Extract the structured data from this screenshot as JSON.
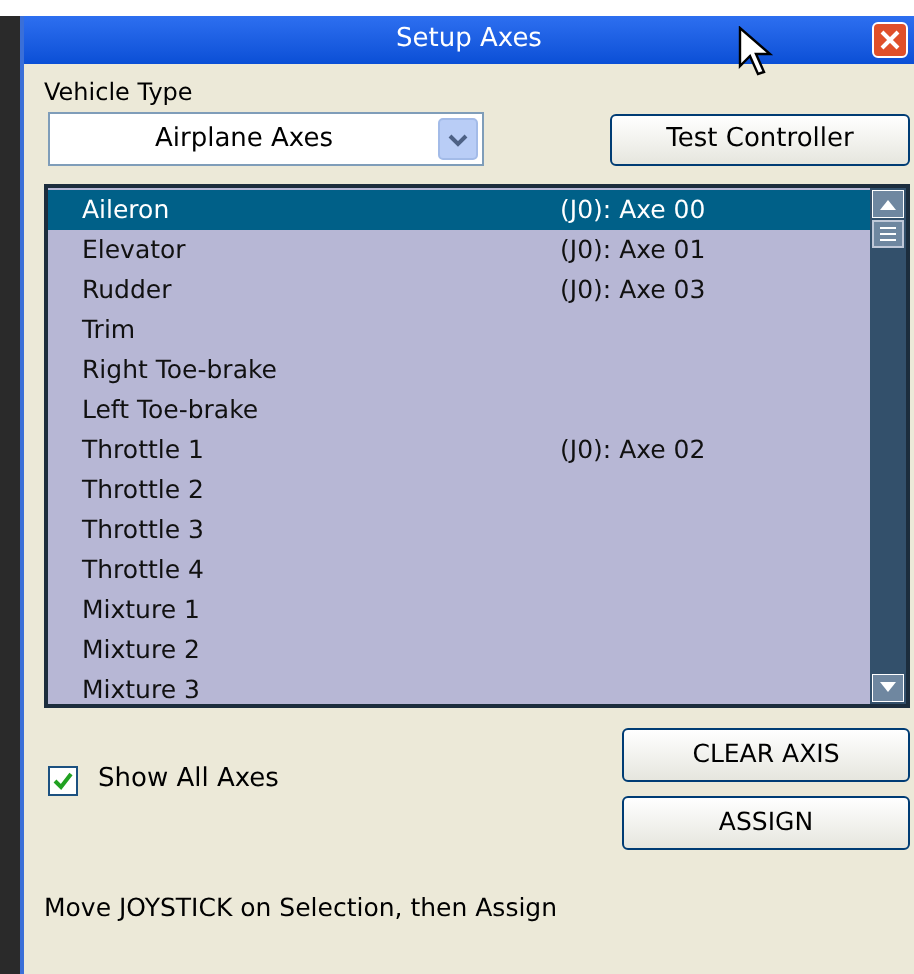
{
  "window": {
    "title": "Setup Axes"
  },
  "vehicle_type": {
    "label": "Vehicle Type",
    "value": "Airplane Axes"
  },
  "test_button": "Test Controller",
  "axes": [
    {
      "name": "Aileron",
      "assignment": "(J0): Axe 00",
      "selected": true
    },
    {
      "name": "Elevator",
      "assignment": "(J0): Axe 01",
      "selected": false
    },
    {
      "name": "Rudder",
      "assignment": "(J0): Axe 03",
      "selected": false
    },
    {
      "name": "Trim",
      "selected": false
    },
    {
      "name": "Right Toe-brake",
      "selected": false
    },
    {
      "name": "Left Toe-brake",
      "selected": false
    },
    {
      "name": "Throttle 1",
      "assignment": "(J0): Axe 02",
      "selected": false
    },
    {
      "name": "Throttle 2",
      "selected": false
    },
    {
      "name": "Throttle 3",
      "selected": false
    },
    {
      "name": "Throttle 4",
      "selected": false
    },
    {
      "name": "Mixture 1",
      "selected": false
    },
    {
      "name": "Mixture 2",
      "selected": false
    },
    {
      "name": "Mixture 3",
      "selected": false
    }
  ],
  "show_all_axes": {
    "label": "Show All Axes",
    "checked": true
  },
  "buttons": [
    "CLEAR AXIS",
    "ASSIGN"
  ],
  "status": "Move JOYSTICK on Selection, then Assign"
}
